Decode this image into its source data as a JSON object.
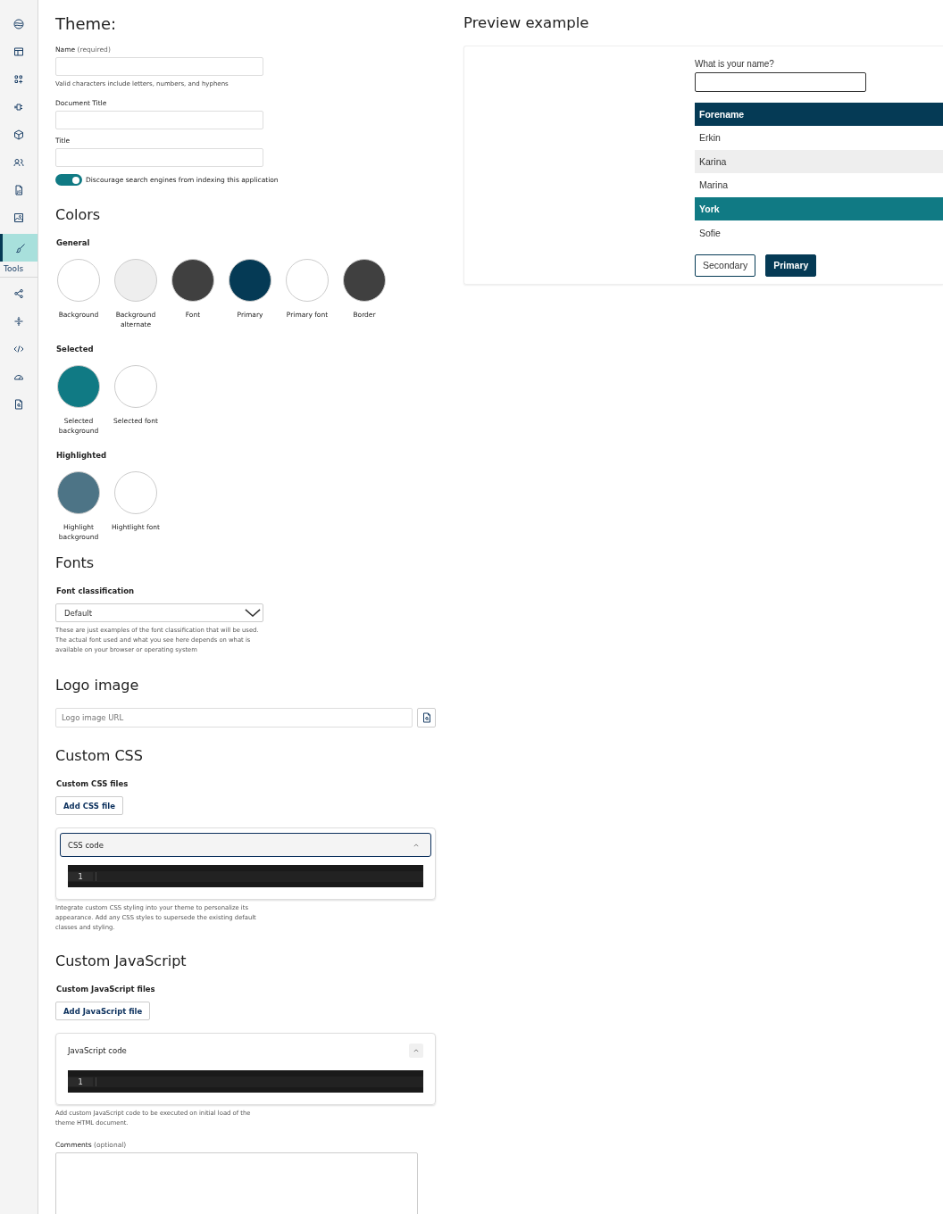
{
  "sidebar": {
    "items": [
      {
        "selected": false
      },
      {
        "selected": false
      },
      {
        "selected": false
      },
      {
        "selected": false
      },
      {
        "selected": false
      },
      {
        "selected": false
      },
      {
        "selected": false
      },
      {
        "selected": false
      },
      {
        "selected": true,
        "label": "Tools"
      },
      {
        "selected": false
      },
      {
        "selected": false
      },
      {
        "selected": false
      },
      {
        "selected": false
      },
      {
        "selected": false
      }
    ]
  },
  "theme": {
    "heading": "Theme:",
    "fields": [
      {
        "label": "Name",
        "qualifier": "(required)",
        "hint": "Valid characters include letters, numbers, and hyphens"
      },
      {
        "label": "Document Title"
      },
      {
        "label": "Title"
      }
    ],
    "toggle": {
      "label": "Discourage search engines from indexing this application",
      "on": true
    }
  },
  "colors": {
    "heading": "Colors",
    "groups": [
      {
        "title": "General",
        "swatches": [
          {
            "label": "Background",
            "color": "#ffffff"
          },
          {
            "label": "Background alternate",
            "color": "#eeeeee"
          },
          {
            "label": "Font",
            "color": "#404040"
          },
          {
            "label": "Primary",
            "color": "#053a55"
          },
          {
            "label": "Primary font",
            "color": "#ffffff"
          },
          {
            "label": "Border",
            "color": "#404040"
          }
        ]
      },
      {
        "title": "Selected",
        "swatches": [
          {
            "label": "Selected background",
            "color": "#107a84"
          },
          {
            "label": "Selected font",
            "color": "#ffffff"
          }
        ]
      },
      {
        "title": "Highlighted",
        "swatches": [
          {
            "label": "Highlight background",
            "color": "#4d7486"
          },
          {
            "label": "Hightlight font",
            "color": "#ffffff"
          }
        ]
      }
    ]
  },
  "fonts": {
    "heading": "Fonts",
    "label": "Font classification",
    "value": "Default",
    "help": "These are just examples of the font classification that will be used. The actual font used and what you see here depends on what is available on your browser or operating system"
  },
  "logo_image": {
    "heading": "Logo image",
    "placeholder": "Logo image URL"
  },
  "custom_css": {
    "heading": "Custom CSS",
    "files_label": "Custom CSS files",
    "add_button": "Add CSS file",
    "editor": {
      "title": "CSS code",
      "focused": true,
      "line_number": "1"
    },
    "help": "Integrate custom CSS styling into your theme to personalize its appearance. Add any CSS styles to supersede the existing default classes and styling."
  },
  "custom_js": {
    "heading": "Custom JavaScript",
    "files_label": "Custom JavaScript files",
    "add_button": "Add JavaScript file",
    "editor": {
      "title": "JavaScript code",
      "focused": false,
      "line_number": "1"
    },
    "help": "Add custom JavaScript code to be executed on initial load of the theme HTML document."
  },
  "comments": {
    "label": "Comments",
    "qualifier": "(optional)"
  },
  "preview": {
    "heading": "Preview example",
    "question": "What is your name?",
    "table": {
      "columns": [
        "Forename"
      ],
      "rows": [
        {
          "cells": [
            "Erkin"
          ],
          "selected": false
        },
        {
          "cells": [
            "Karina"
          ],
          "selected": false
        },
        {
          "cells": [
            "Marina"
          ],
          "selected": false
        },
        {
          "cells": [
            "York"
          ],
          "selected": true
        },
        {
          "cells": [
            "Sofie"
          ],
          "selected": false
        }
      ]
    },
    "buttons": [
      {
        "label": "Secondary",
        "kind": "secondary"
      },
      {
        "label": "Primary",
        "kind": "primary"
      }
    ]
  }
}
